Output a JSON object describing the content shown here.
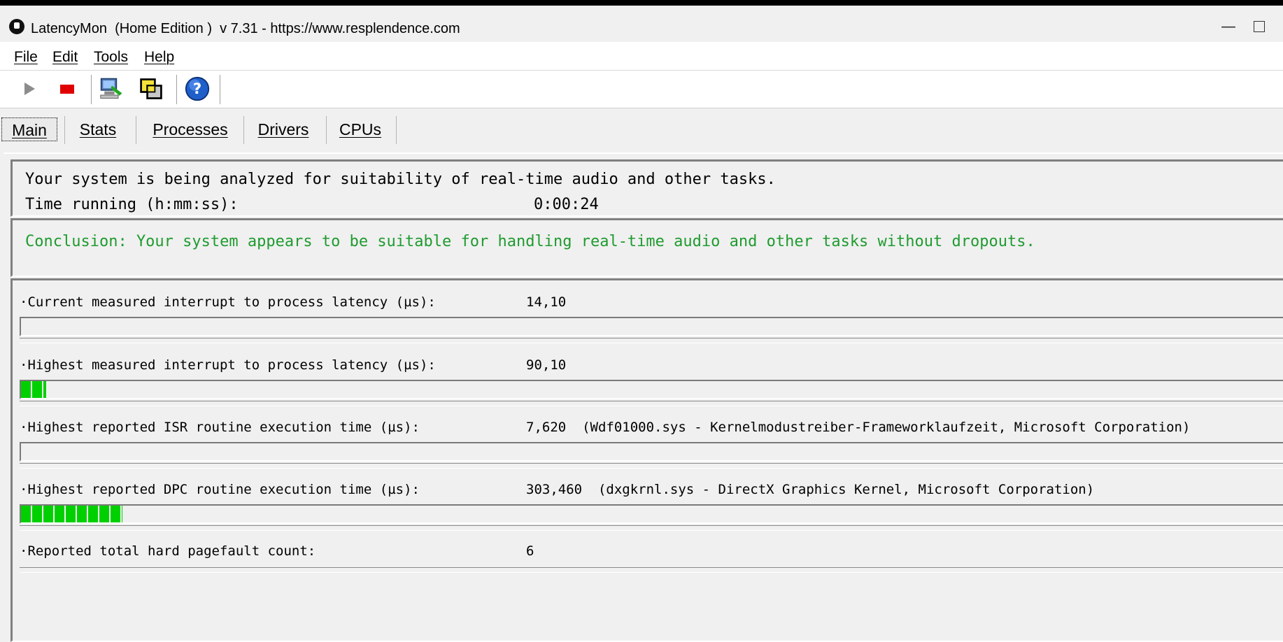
{
  "window": {
    "title": "LatencyMon  (Home Edition )  v 7.31 - https://www.resplendence.com",
    "minimize_glyph": "—"
  },
  "menu": {
    "items": [
      {
        "label": "File"
      },
      {
        "label": "Edit"
      },
      {
        "label": "Tools"
      },
      {
        "label": "Help"
      }
    ]
  },
  "toolbar": {
    "buttons": [
      {
        "icon": "play-icon"
      },
      {
        "icon": "stop-icon"
      },
      {
        "icon": "computer-monitor-icon"
      },
      {
        "icon": "windows-stack-icon"
      },
      {
        "icon": "help-icon"
      }
    ]
  },
  "tabs": [
    {
      "label": "Main",
      "selected": true
    },
    {
      "label": "Stats"
    },
    {
      "label": "Processes"
    },
    {
      "label": "Drivers"
    },
    {
      "label": "CPUs"
    }
  ],
  "status": {
    "analyzing_text": "Your system is being analyzed for suitability of real-time audio and other tasks.",
    "time_label": "Time running (h:mm:ss):",
    "time_value": "0:00:24"
  },
  "conclusion": {
    "text": "Conclusion: Your system appears to be suitable for handling real-time audio and other tasks without dropouts.",
    "color": "#1f9b2f"
  },
  "metrics": [
    {
      "label": "·Current measured interrupt to process latency (µs):",
      "value": "14,10",
      "bar_fraction": 0.0
    },
    {
      "label": "·Highest measured interrupt to process latency (µs):",
      "value": "90,10",
      "bar_fraction": 0.02
    },
    {
      "label": "·Highest reported ISR routine execution time (µs):",
      "value": "7,620  (Wdf01000.sys - Kernelmodustreiber-Frameworklaufzeit, Microsoft Corporation)",
      "bar_fraction": 0.0
    },
    {
      "label": "·Highest reported DPC routine execution time (µs):",
      "value": "303,460  (dxgkrnl.sys - DirectX Graphics Kernel, Microsoft Corporation)",
      "bar_fraction": 0.08
    },
    {
      "label": "·Reported total hard pagefault count:",
      "value": "6"
    }
  ]
}
